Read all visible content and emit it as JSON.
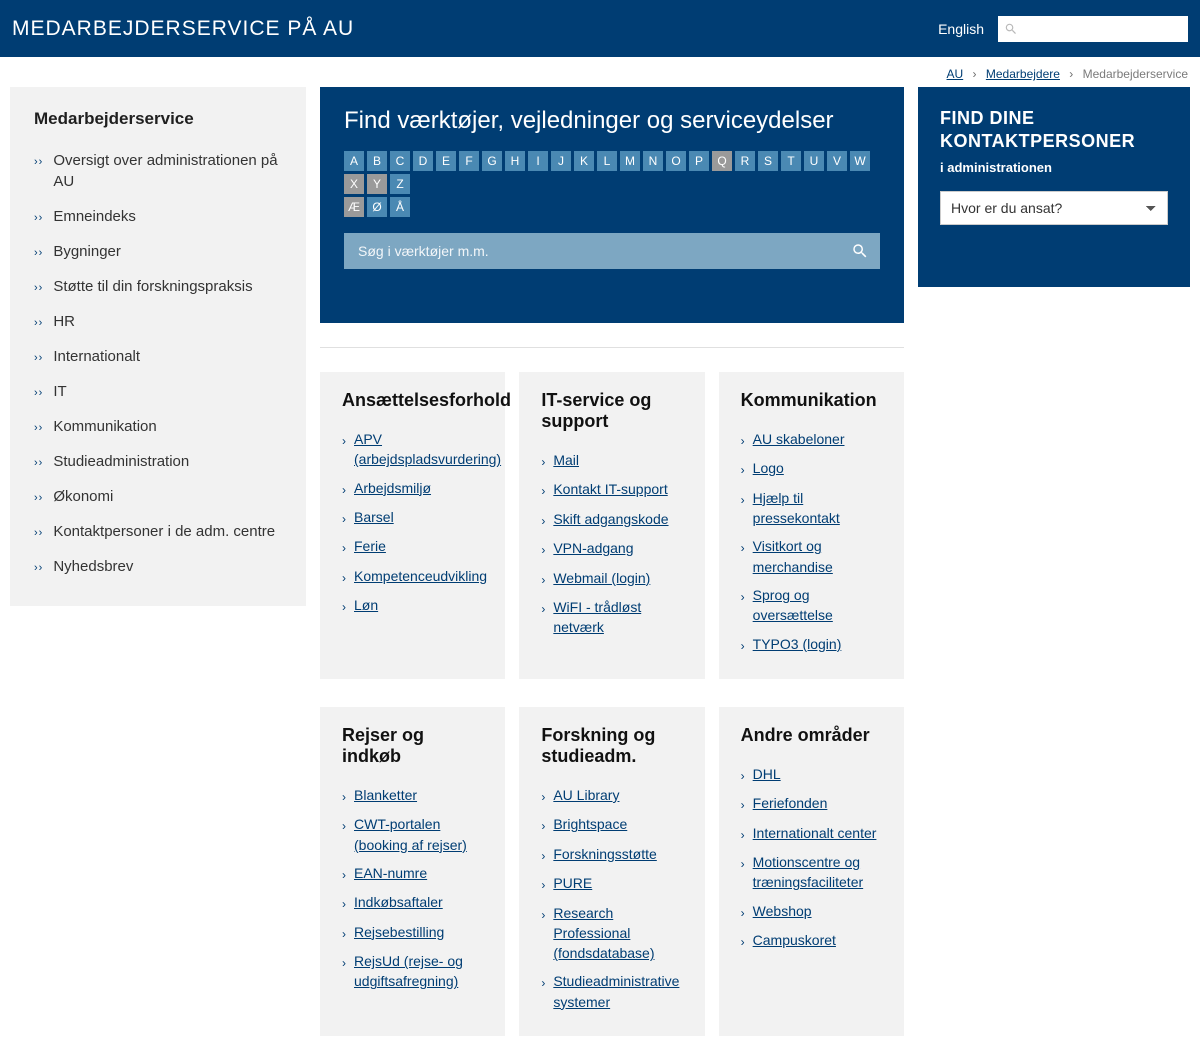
{
  "header": {
    "title": "MEDARBEJDERSERVICE PÅ AU",
    "lang": "English"
  },
  "breadcrumb": {
    "items": [
      "AU",
      "Medarbejdere"
    ],
    "current": "Medarbejderservice"
  },
  "sidebar": {
    "title": "Medarbejderservice",
    "items": [
      "Oversigt over administrationen på AU",
      "Emneindeks",
      "Bygninger",
      "Støtte til din forskningspraksis",
      "HR",
      "Internationalt",
      "IT",
      "Kommunikation",
      "Studieadministration",
      "Økonomi",
      "Kontaktpersoner i de adm. centre",
      "Nyhedsbrev"
    ]
  },
  "find": {
    "title": "Find værktøjer, vejledninger og serviceydelser",
    "letters_row1": [
      {
        "l": "A",
        "on": true
      },
      {
        "l": "B",
        "on": true
      },
      {
        "l": "C",
        "on": true
      },
      {
        "l": "D",
        "on": true
      },
      {
        "l": "E",
        "on": true
      },
      {
        "l": "F",
        "on": true
      },
      {
        "l": "G",
        "on": true
      },
      {
        "l": "H",
        "on": true
      },
      {
        "l": "I",
        "on": true
      },
      {
        "l": "J",
        "on": true
      },
      {
        "l": "K",
        "on": true
      },
      {
        "l": "L",
        "on": true
      },
      {
        "l": "M",
        "on": true
      },
      {
        "l": "N",
        "on": true
      },
      {
        "l": "O",
        "on": true
      },
      {
        "l": "P",
        "on": true
      },
      {
        "l": "Q",
        "on": false
      },
      {
        "l": "R",
        "on": true
      },
      {
        "l": "S",
        "on": true
      },
      {
        "l": "T",
        "on": true
      },
      {
        "l": "U",
        "on": true
      },
      {
        "l": "V",
        "on": true
      },
      {
        "l": "W",
        "on": true
      },
      {
        "l": "X",
        "on": false
      },
      {
        "l": "Y",
        "on": false
      },
      {
        "l": "Z",
        "on": true
      }
    ],
    "letters_row2": [
      {
        "l": "Æ",
        "on": false
      },
      {
        "l": "Ø",
        "on": true
      },
      {
        "l": "Å",
        "on": true
      }
    ],
    "placeholder": "Søg i værktøjer m.m."
  },
  "contacts": {
    "title": "FIND DINE KONTAKTPERSONER",
    "sub": "i administrationen",
    "select": "Hvor er du ansat?"
  },
  "cards": [
    [
      {
        "title": "Ansættelsesforhold",
        "items": [
          "APV (arbejdspladsvurdering)",
          "Arbejdsmiljø",
          "Barsel",
          "Ferie",
          "Kompetenceudvikling",
          "Løn"
        ]
      },
      {
        "title": "IT-service og support",
        "items": [
          "Mail",
          "Kontakt IT-support",
          "Skift adgangskode",
          "VPN-adgang",
          "Webmail (login)",
          "WiFI - trådløst netværk"
        ]
      },
      {
        "title": "Kommunikation",
        "items": [
          "AU skabeloner",
          "Logo",
          "Hjælp til pressekontakt",
          "Visitkort og merchandise",
          "Sprog og oversættelse",
          "TYPO3 (login)"
        ]
      }
    ],
    [
      {
        "title": "Rejser og indkøb",
        "items": [
          "Blanketter",
          "CWT-portalen (booking af rejser)",
          "EAN-numre",
          "Indkøbsaftaler",
          "Rejsebestilling",
          "RejsUd (rejse- og udgiftsafregning)"
        ]
      },
      {
        "title": "Forskning og studieadm.",
        "items": [
          "AU Library",
          "Brightspace",
          "Forskningsstøtte",
          "PURE",
          "Research Professional (fondsdatabase)",
          "Studieadministrative systemer"
        ]
      },
      {
        "title": "Andre områder",
        "items": [
          "DHL",
          "Feriefonden",
          "Internationalt center",
          "Motionscentre og træningsfaciliteter",
          "Webshop",
          "Campuskoret"
        ]
      }
    ]
  ]
}
